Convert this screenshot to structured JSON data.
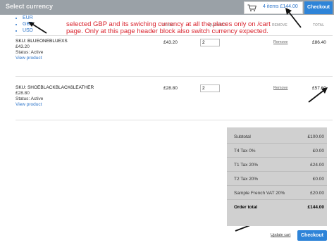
{
  "header": {
    "currency_title": "Select currency",
    "cart_summary": "4 items £144.00",
    "checkout_label": "Checkout"
  },
  "currency_menu": {
    "options": [
      "EUR",
      "GBP",
      "USD"
    ]
  },
  "columns": {
    "price": "PRICE",
    "quantity": "QUANTITY",
    "remove": "REMOVE",
    "total": "TOTAL"
  },
  "annotation": {
    "note": "selected GBP and its swiching currency at all the places only on /cart page. Only at this page header block also switch currency expected."
  },
  "items": [
    {
      "sku": "SKU: BLUEONEBLUEXS",
      "unit_price": "£43.20",
      "status": "Status: Active",
      "view_link": "View product",
      "price": "£43.20",
      "qty": "2",
      "remove": "Remove",
      "total": "£86.40"
    },
    {
      "sku": "SKU: SHOEBLACKBLACK6LEATHER",
      "unit_price": "£28.80",
      "status": "Status: Active",
      "view_link": "View product",
      "price": "£28.80",
      "qty": "2",
      "remove": "Remove",
      "total": "£57.60"
    }
  ],
  "totals": [
    {
      "label": "Subtotal",
      "value": "£100.00"
    },
    {
      "label": "T4 Tax 0%",
      "value": "£0.00"
    },
    {
      "label": "T1 Tax 20%",
      "value": "£24.00"
    },
    {
      "label": "T2 Tax 20%",
      "value": "£0.00"
    },
    {
      "label": "Sample French VAT 20%",
      "value": "£20.00"
    },
    {
      "label": "Order total",
      "value": "£144.00"
    }
  ],
  "footer": {
    "update_label": "Update cart",
    "checkout_label": "Checkout"
  },
  "colors": {
    "header_bg": "#9aa1a7",
    "link": "#2a73c9",
    "button": "#2e84d8",
    "note": "#d9232d",
    "totals_bg": "#d0d0d0"
  }
}
